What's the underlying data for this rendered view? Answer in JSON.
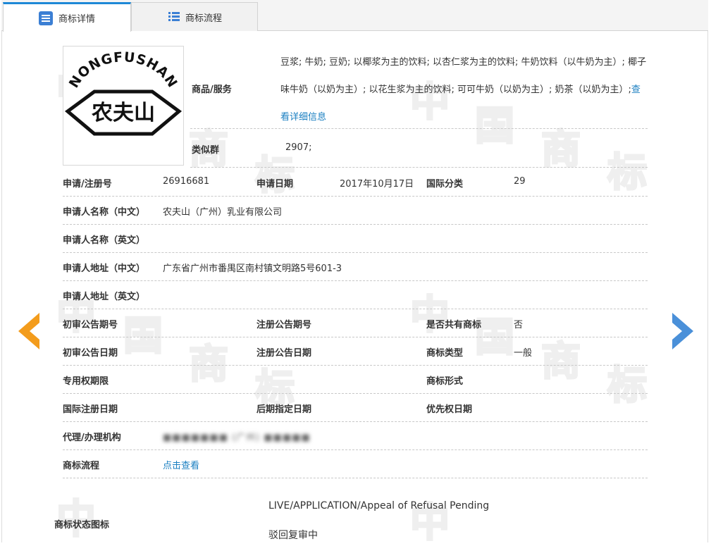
{
  "tabs": [
    {
      "label": "商标详情",
      "active": true
    },
    {
      "label": "商标流程",
      "active": false
    }
  ],
  "logo": {
    "brand_latin": "NONGFUSHAN",
    "brand_cn": "农夫山"
  },
  "goods": {
    "label": "商品/服务",
    "text": "豆浆; 牛奶; 豆奶; 以椰浆为主的饮料; 以杏仁浆为主的饮料; 牛奶饮料（以牛奶为主）; 椰子味牛奶（以奶为主）; 以花生浆为主的饮料; 可可牛奶（以奶为主）; 奶茶（以奶为主）;",
    "detail_link": "查看详细信息"
  },
  "similar_group": {
    "label": "类似群",
    "value": "2907;"
  },
  "fields": {
    "reg_no_label": "申请/注册号",
    "reg_no": "26916681",
    "apply_date_label": "申请日期",
    "apply_date": "2017年10月17日",
    "intl_class_label": "国际分类",
    "intl_class": "29",
    "applicant_cn_label": "申请人名称（中文）",
    "applicant_cn": "农夫山（广州）乳业有限公司",
    "applicant_en_label": "申请人名称（英文）",
    "applicant_en": "",
    "addr_cn_label": "申请人地址（中文）",
    "addr_cn": "广东省广州市番禺区南村镇文明路5号601-3",
    "addr_en_label": "申请人地址（英文）",
    "addr_en": "",
    "prelim_no_label": "初审公告期号",
    "prelim_no": "",
    "reg_notice_no_label": "注册公告期号",
    "reg_notice_no": "",
    "shared_label": "是否共有商标",
    "shared": "否",
    "prelim_date_label": "初审公告日期",
    "prelim_date": "",
    "reg_notice_date_label": "注册公告日期",
    "reg_notice_date": "",
    "tm_type_label": "商标类型",
    "tm_type": "一般",
    "exclusive_label": "专用权期限",
    "exclusive": "",
    "tm_form_label": "商标形式",
    "tm_form": "",
    "intl_reg_date_label": "国际注册日期",
    "intl_reg_date": "",
    "later_date_label": "后期指定日期",
    "later_date": "",
    "priority_label": "优先权日期",
    "priority": "",
    "agent_label": "代理/办理机构",
    "agent": "■■■■■■■ (广州) ■■■■■",
    "flow_label": "商标流程",
    "flow_link": "点击查看"
  },
  "status": {
    "label": "商标状态图标",
    "en": "LIVE/APPLICATION/Appeal of Refusal Pending",
    "cn": "驳回复审中"
  },
  "watermark": [
    "中",
    "国",
    "商",
    "标"
  ],
  "colors": {
    "accent": "#1e88d6",
    "link": "#1a7fc1",
    "prev_arrow": "#f39c1c",
    "next_arrow": "#4a90d9"
  }
}
